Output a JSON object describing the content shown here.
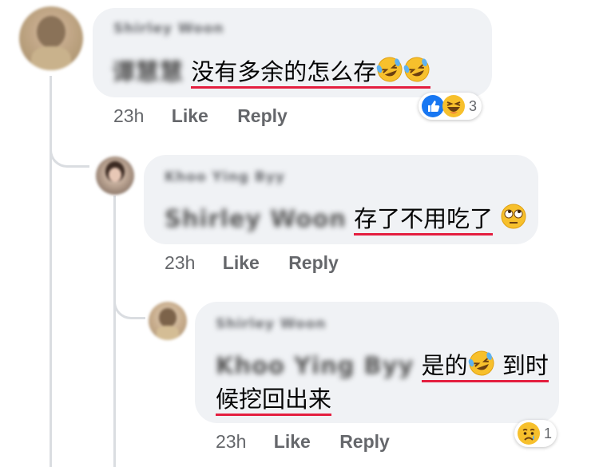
{
  "comments": [
    {
      "author": "Shirley Woon",
      "mention": "谭慧慧",
      "text": "没有多余的怎么存",
      "time": "23h",
      "like_label": "Like",
      "reply_label": "Reply",
      "reaction_count": "3",
      "reaction_icons": [
        "like-icon",
        "haha-icon"
      ]
    },
    {
      "author": "Khoo Ying Byy",
      "mention": "Shirley Woon",
      "text": "存了不用吃了",
      "time": "23h",
      "like_label": "Like",
      "reply_label": "Reply"
    },
    {
      "author": "Shirley Woon",
      "mention": "Khoo Ying Byy",
      "text_part1": "是的",
      "text_part2": "到时",
      "text_line2": "候挖回出来",
      "time": "23h",
      "like_label": "Like",
      "reply_label": "Reply",
      "reaction_count": "1",
      "reaction_icons": [
        "sad-icon"
      ]
    }
  ],
  "colors": {
    "bubble": "#f0f2f5",
    "meta": "#65676b",
    "underline": "#e41e3f",
    "thread": "#dadde1"
  }
}
